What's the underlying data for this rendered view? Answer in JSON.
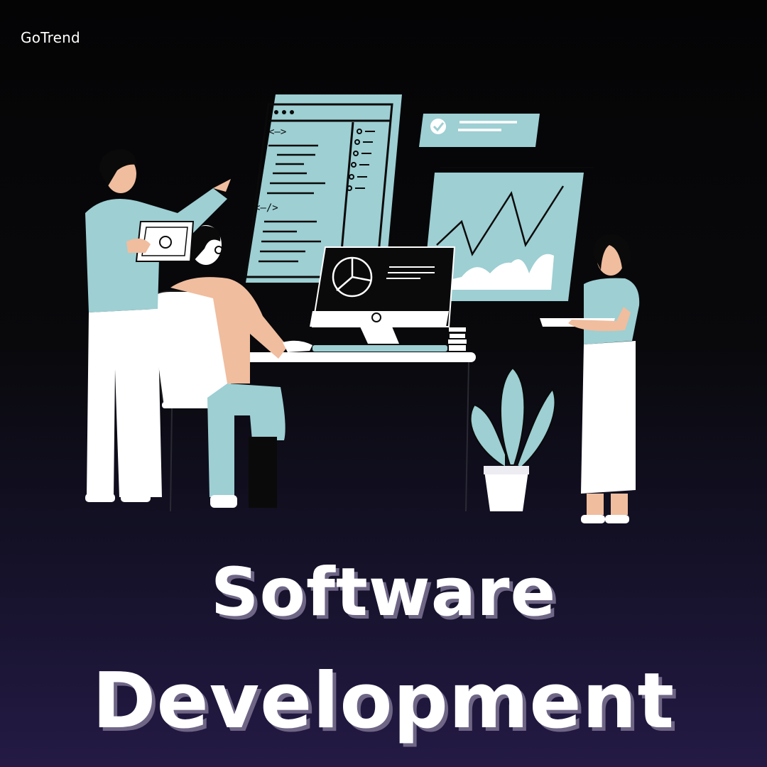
{
  "brand": {
    "name": "GoTrend"
  },
  "headline": {
    "line1": "Software",
    "line2": "Development"
  },
  "colors": {
    "background_top": "#040405",
    "background_bottom": "#241a45",
    "accent": "#9dcfd3",
    "text": "#ffffff",
    "shadow": "#6f6686"
  },
  "illustration": {
    "code_tags": [
      "<—>",
      "<—/>"
    ],
    "icons": [
      "pie-chart-icon",
      "check-icon",
      "line-chart-icon"
    ]
  }
}
